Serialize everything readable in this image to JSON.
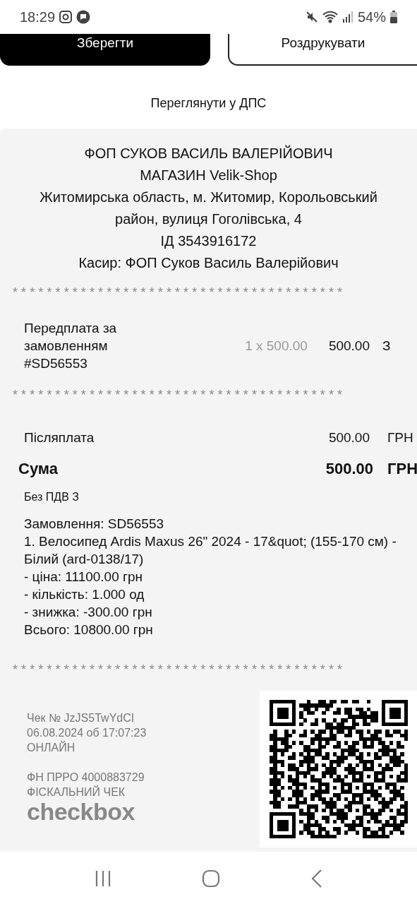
{
  "status_bar": {
    "time": "18:29",
    "battery": "54%"
  },
  "actions": [
    {
      "label": "Зберегти",
      "kind": "primary"
    },
    {
      "label": "Роздрукувати",
      "kind": "outline"
    }
  ],
  "link": "Переглянути у ДПС",
  "receipt": {
    "header": [
      "ФОП СУКОВ ВАСИЛЬ ВАЛЕРІЙОВИЧ",
      "МАГАЗИН Velik-Shop",
      "Житомирська область, м. Житомир, Корольовський район, вулиця Гоголівська, 4",
      "ІД 3543916172",
      "Касир: ФОП Суков Василь Валерійович"
    ],
    "separator": "***************************************",
    "items": [
      {
        "name": "Передплата за замовленням #SD56553",
        "quantity": "1 x 500.00",
        "amount": "500.00",
        "tax": "З"
      }
    ],
    "payments": [
      {
        "label": "Післяплата",
        "amount": "500.00",
        "currency": "ГРН",
        "kind": "regular"
      },
      {
        "label": "Сума",
        "amount": "500.00",
        "currency": "ГРН",
        "kind": "total"
      }
    ],
    "tax_note": "Без ПДВ З",
    "comment": [
      "Замовлення: SD56553",
      "1. Велосипед Ardis Maxus 26\" 2024 - 17&quot; (155-170 см) - Білий (ard-0138/17)",
      "- ціна: 11100.00 грн",
      "- кількість: 1.000 од",
      "- знижка: -300.00 грн",
      "Всього: 10800.00 грн"
    ],
    "footer": {
      "check_lines": [
        "Чек № JzJS5TwYdCI",
        "06.08.2024 об 17:07:23",
        "ОНЛАЙН"
      ],
      "fiscal_lines": [
        "ФН ПРРО 4000883729",
        "ФІСКАЛЬНИЙ ЧЕК"
      ],
      "brand": "checkbox"
    }
  }
}
